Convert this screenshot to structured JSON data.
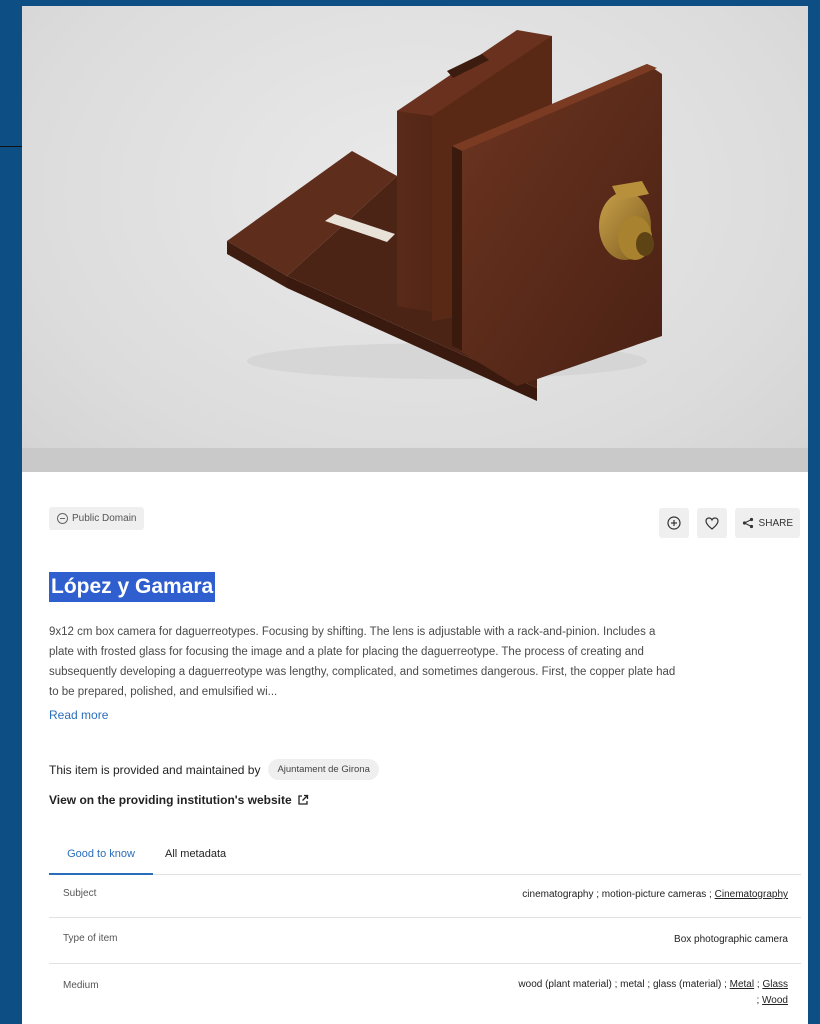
{
  "license": {
    "label": "Public Domain"
  },
  "actions": {
    "share_label": "SHARE"
  },
  "item": {
    "title": "López y Gamara",
    "description_lines": [
      "9x12 cm box camera for daguerreotypes. Focusing by shifting. The lens is adjustable with a rack-and-pinion. Includes a",
      "plate with frosted glass for focusing the image and a plate for placing the daguerreotype. The process of creating and",
      "subsequently developing a daguerreotype was lengthy, complicated, and sometimes dangerous. First, the copper plate had",
      "to be prepared, polished, and emulsified wi..."
    ],
    "read_more": "Read more"
  },
  "provider": {
    "text": "This item is provided and maintained by",
    "name": "Ajuntament de Girona",
    "institution_link": "View on the providing institution's website"
  },
  "tabs": [
    "Good to know",
    "All metadata"
  ],
  "metadata": {
    "subject": {
      "label": "Subject",
      "v1": "cinematography",
      "sep1": " ; ",
      "v2": "motion-picture cameras",
      "sep2": " ; ",
      "v3": "Cinematography"
    },
    "type": {
      "label": "Type of item",
      "value": "Box photographic camera"
    },
    "medium": {
      "label": "Medium",
      "v1": "wood (plant material)",
      "sep1": " ; ",
      "v2": "metal",
      "sep2": " ; ",
      "v3": "glass (material)",
      "sep3": " ; ",
      "v4": "Metal",
      "sep4": " ; ",
      "v5": "Glass",
      "sep5": " ; ",
      "v6": "Wood"
    }
  },
  "colors": {
    "accent": "#2a6ebb",
    "title_highlight": "#2f5fcf",
    "frame": "#0d4f85"
  }
}
